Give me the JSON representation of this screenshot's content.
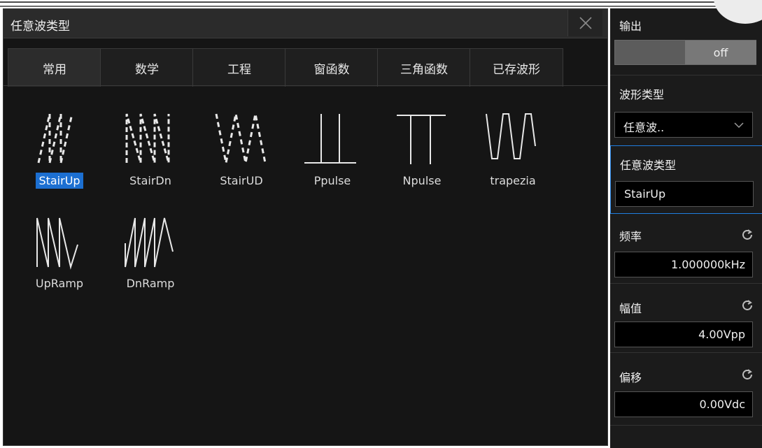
{
  "dialog": {
    "title": "任意波类型",
    "tabs": [
      "常用",
      "数学",
      "工程",
      "窗函数",
      "三角函数",
      "已存波形"
    ],
    "active_tab": 0,
    "waveforms": [
      {
        "label": "StairUp",
        "icon": "stair-up-wave-icon",
        "selected": true
      },
      {
        "label": "StairDn",
        "icon": "stair-down-wave-icon",
        "selected": false
      },
      {
        "label": "StairUD",
        "icon": "stair-up-down-wave-icon",
        "selected": false
      },
      {
        "label": "Ppulse",
        "icon": "positive-pulse-wave-icon",
        "selected": false
      },
      {
        "label": "Npulse",
        "icon": "negative-pulse-wave-icon",
        "selected": false
      },
      {
        "label": "trapezia",
        "icon": "trapezia-wave-icon",
        "selected": false
      },
      {
        "label": "UpRamp",
        "icon": "up-ramp-wave-icon",
        "selected": false
      },
      {
        "label": "DnRamp",
        "icon": "down-ramp-wave-icon",
        "selected": false
      }
    ],
    "close_icon": "close-icon"
  },
  "panel": {
    "output": {
      "label": "输出",
      "state": "off"
    },
    "wave_type": {
      "label": "波形类型",
      "value": "任意波..",
      "icon": "chevron-down-icon"
    },
    "arb_type": {
      "label": "任意波类型",
      "value": "StairUp"
    },
    "frequency": {
      "label": "频率",
      "value": "1.000000kHz",
      "icon": "reset-icon"
    },
    "amplitude": {
      "label": "幅值",
      "value": "4.00Vpp",
      "icon": "reset-icon"
    },
    "offset": {
      "label": "偏移",
      "value": "0.00Vdc",
      "icon": "reset-icon"
    }
  },
  "colors": {
    "background": "#151515",
    "selection": "#1c6fd1",
    "panel": "#1b1b1b",
    "highlight_border": "#1f7ee0"
  }
}
